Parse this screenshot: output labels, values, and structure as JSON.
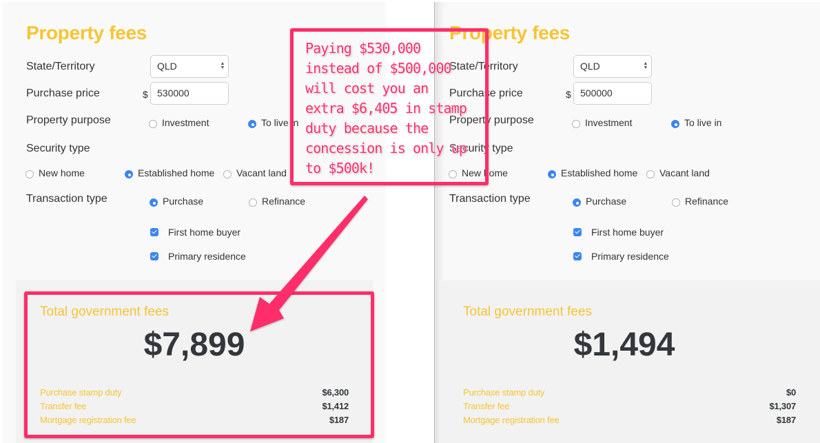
{
  "colors": {
    "accent_yellow": "#f6c533",
    "annotation_pink": "#ff2e6b",
    "radio_blue": "#3b86f0",
    "text_dark": "#33373b"
  },
  "left": {
    "title": "Property fees",
    "state_label": "State/Territory",
    "state_value": "QLD",
    "price_label": "Purchase price",
    "currency_symbol": "$",
    "price_value": "530000",
    "purpose_label": "Property purpose",
    "purpose_options": [
      {
        "label": "Investment",
        "selected": false
      },
      {
        "label": "To live in",
        "selected": true
      }
    ],
    "security_label": "Security type",
    "security_options": [
      {
        "label": "New home",
        "selected": false
      },
      {
        "label": "Established home",
        "selected": true
      },
      {
        "label": "Vacant land",
        "selected": false
      }
    ],
    "transaction_label": "Transaction type",
    "transaction_options": [
      {
        "label": "Purchase",
        "selected": true
      },
      {
        "label": "Refinance",
        "selected": false
      }
    ],
    "checkboxes": [
      {
        "label": "First home buyer",
        "checked": true
      },
      {
        "label": "Primary residence",
        "checked": true
      }
    ],
    "results": {
      "title": "Total government fees",
      "total": "$7,899",
      "fees": [
        {
          "name": "Purchase stamp duty",
          "value": "$6,300"
        },
        {
          "name": "Transfer fee",
          "value": "$1,412"
        },
        {
          "name": "Mortgage registration fee",
          "value": "$187"
        }
      ]
    }
  },
  "right": {
    "title": "Property fees",
    "state_label": "State/Territory",
    "state_value": "QLD",
    "price_label": "Purchase price",
    "currency_symbol": "$",
    "price_value": "500000",
    "purpose_label": "Property purpose",
    "purpose_options": [
      {
        "label": "Investment",
        "selected": false
      },
      {
        "label": "To live in",
        "selected": true
      }
    ],
    "security_label": "Security type",
    "security_options": [
      {
        "label": "New home",
        "selected": false
      },
      {
        "label": "Established home",
        "selected": true
      },
      {
        "label": "Vacant land",
        "selected": false
      }
    ],
    "transaction_label": "Transaction type",
    "transaction_options": [
      {
        "label": "Purchase",
        "selected": true
      },
      {
        "label": "Refinance",
        "selected": false
      }
    ],
    "checkboxes": [
      {
        "label": "First home buyer",
        "checked": true
      },
      {
        "label": "Primary residence",
        "checked": true
      }
    ],
    "results": {
      "title": "Total government fees",
      "total": "$1,494",
      "fees": [
        {
          "name": "Purchase stamp duty",
          "value": "$0"
        },
        {
          "name": "Transfer fee",
          "value": "$1,307"
        },
        {
          "name": "Mortgage registration fee",
          "value": "$187"
        }
      ]
    }
  },
  "annotation": {
    "callout_text": "Paying $530,000\ninstead of $500,000\nwill cost you an\nextra $6,405 in stamp\nduty because the\nconcession is only up\nto $500k!"
  }
}
